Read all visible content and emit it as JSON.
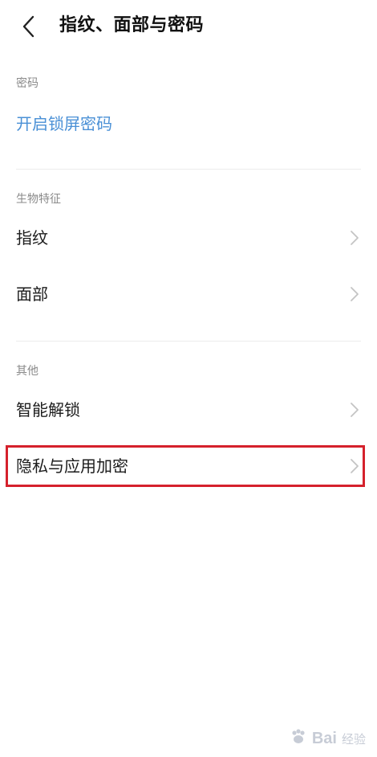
{
  "header": {
    "title": "指纹、面部与密码",
    "back_icon": "chevron-left-icon"
  },
  "sections": {
    "password": {
      "label": "密码",
      "items": [
        {
          "label": "开启锁屏密码",
          "style": "link"
        }
      ]
    },
    "biometrics": {
      "label": "生物特征",
      "items": [
        {
          "label": "指纹"
        },
        {
          "label": "面部"
        }
      ]
    },
    "other": {
      "label": "其他",
      "items": [
        {
          "label": "智能解锁"
        },
        {
          "label": "隐私与应用加密",
          "highlighted": true
        }
      ]
    }
  },
  "watermark": {
    "brand": "Bai",
    "suffix": "经验"
  },
  "colors": {
    "link": "#4a90d6",
    "highlight": "#d5212c",
    "section_label": "#8a8a8a",
    "chevron": "#c4c4c4"
  }
}
